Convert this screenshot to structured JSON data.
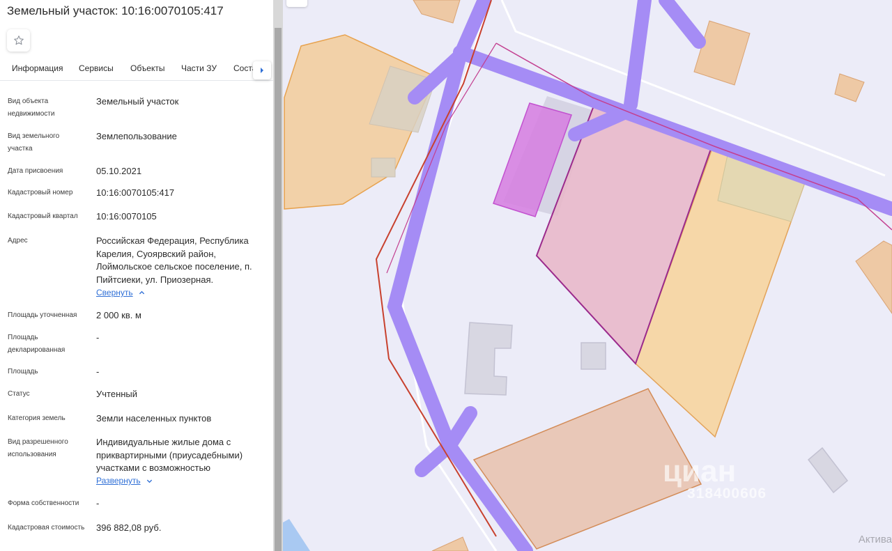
{
  "title": "Земельный участок: 10:16:0070105:417",
  "tabs": [
    "Информация",
    "Сервисы",
    "Объекты",
    "Части ЗУ",
    "Состав"
  ],
  "properties": [
    {
      "label": "Вид объекта недвижимости",
      "value": "Земельный участок"
    },
    {
      "label": "Вид земельного участка",
      "value": "Землепользование"
    },
    {
      "label": "Дата присвоения",
      "value": "05.10.2021"
    },
    {
      "label": "Кадастровый номер",
      "value": "10:16:0070105:417"
    },
    {
      "label": "Кадастровый квартал",
      "value": "10:16:0070105"
    },
    {
      "label": "Адрес",
      "value": "Российская Федерация, Республика Карелия, Суоярвский район, Лоймольское сельское поселение, п. Пийтсиеки, ул. Приозерная.",
      "toggle": "Свернуть"
    },
    {
      "label": "Площадь уточненная",
      "value": "2 000 кв. м"
    },
    {
      "label": "Площадь декларированная",
      "value": "-"
    },
    {
      "label": "Площадь",
      "value": "-"
    },
    {
      "label": "Статус",
      "value": "Учтенный"
    },
    {
      "label": "Категория земель",
      "value": "Земли населенных пунктов"
    },
    {
      "label": "Вид разрешенного использования",
      "value": "Индивидуальные жилые дома с приквартирными (приусадебными) участками с возможностью",
      "toggle": "Развернуть"
    },
    {
      "label": "Форма собственности",
      "value": "-"
    },
    {
      "label": "Кадастровая стоимость",
      "value": "396 882,08 руб."
    }
  ],
  "map": {
    "watermark": "циан",
    "watermark_id": "318400606",
    "activation_text": "Актива",
    "colors": {
      "road": "#a58cf5",
      "parcel_orange": "#f3cfa0",
      "parcel_pink": "#e9b6c8",
      "building": "#d6d2e0",
      "selected_outline": "#9b2a8c"
    }
  },
  "icons": {
    "favorite": "star-icon",
    "tabs_next": "arrow-right-icon",
    "collapse": "chevron-up-icon",
    "expand": "chevron-down-icon"
  }
}
